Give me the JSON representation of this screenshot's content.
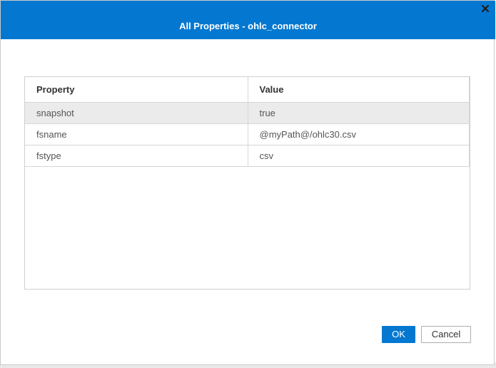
{
  "dialog": {
    "title": "All Properties - ohlc_connector",
    "close_icon": "close-icon",
    "colors": {
      "titlebar": "#0478d0",
      "selected_row": "#ebebeb"
    }
  },
  "table": {
    "headers": [
      "Property",
      "Value"
    ],
    "rows": [
      {
        "property": "snapshot",
        "value": "true",
        "selected": true
      },
      {
        "property": "fsname",
        "value": "@myPath@/ohlc30.csv",
        "selected": false
      },
      {
        "property": "fstype",
        "value": "csv",
        "selected": false
      }
    ]
  },
  "buttons": {
    "ok_label": "OK",
    "cancel_label": "Cancel"
  }
}
